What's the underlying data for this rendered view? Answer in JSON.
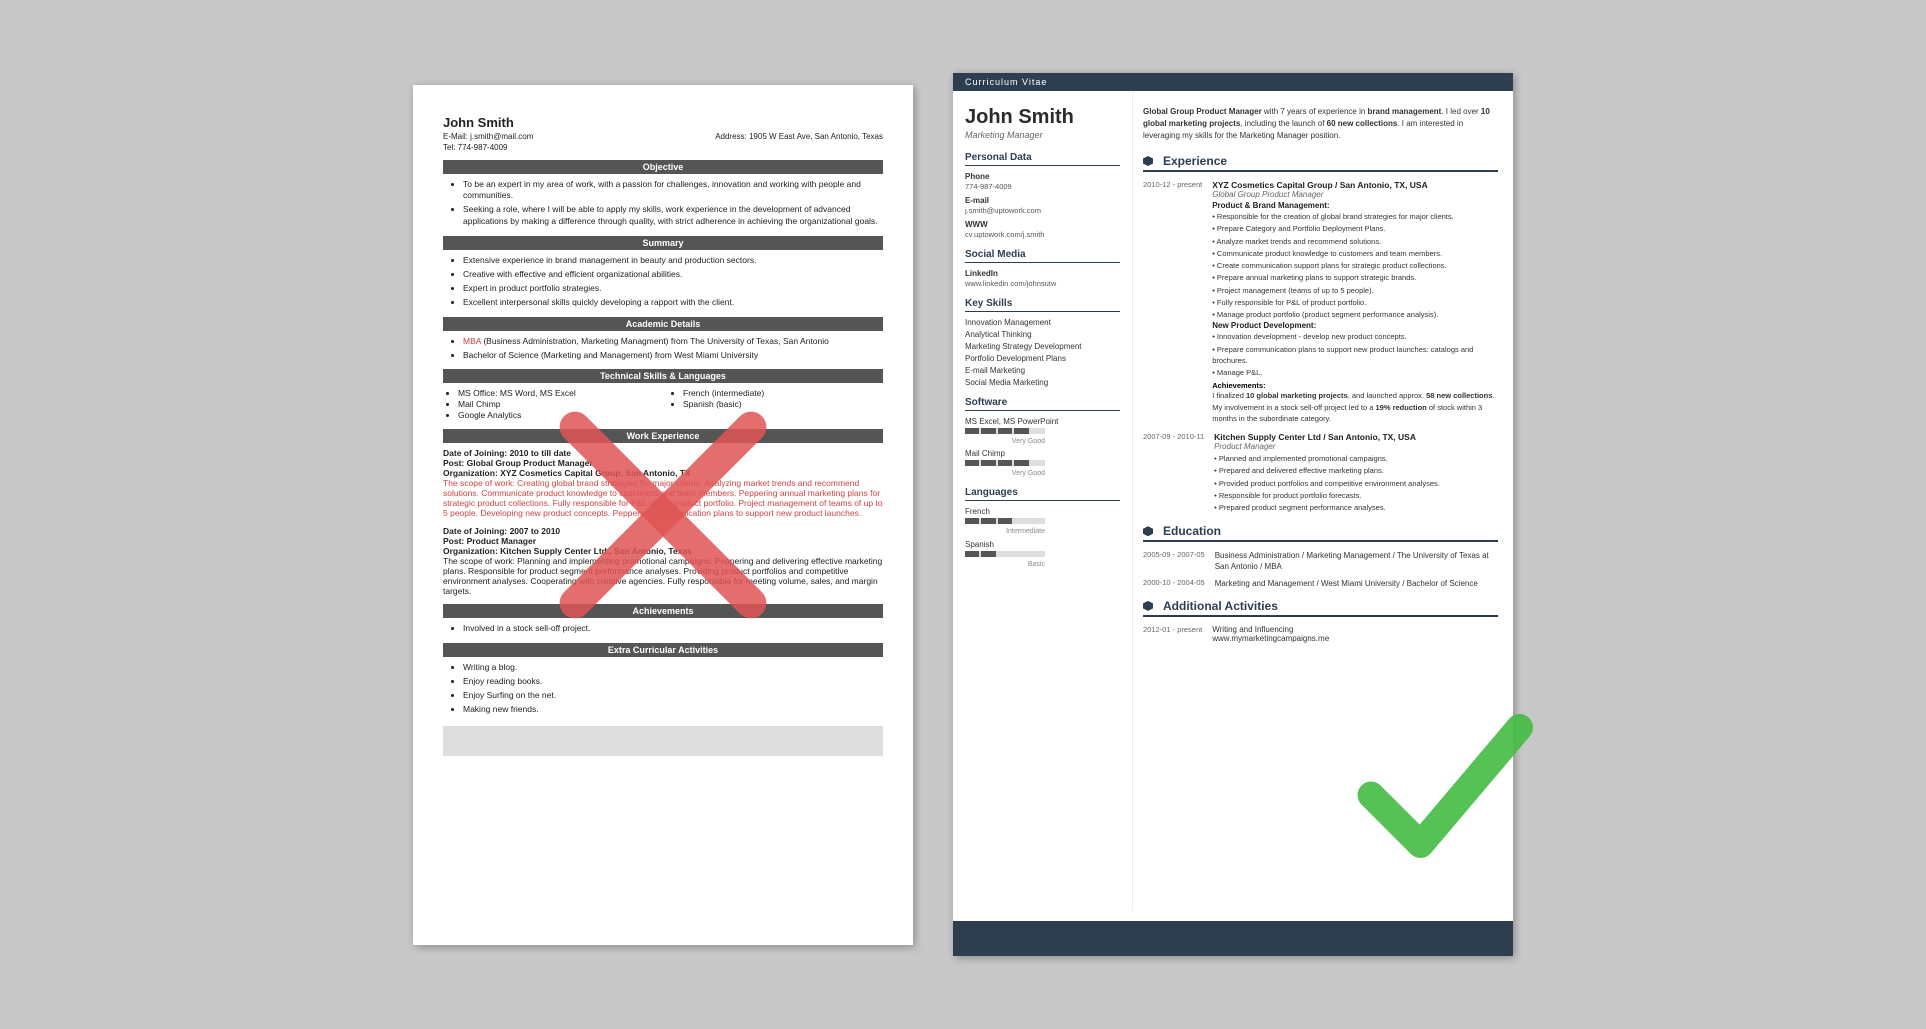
{
  "left_resume": {
    "name": "John Smith",
    "email": "E-Mail: j.smith@mail.com",
    "address": "Address: 1905 W East Ave, San Antonio, Texas",
    "tel": "Tel: 774-987-4009",
    "sections": {
      "objective": {
        "title": "Objective",
        "bullets": [
          "To be an expert in my area of work, with a passion for challenges, innovation and working with people and communities.",
          "Seeking a role, where I will be able to apply my skills, work experience in the development of advanced applications by making a difference through quality, with strict adherence in achieving the organizational goals."
        ]
      },
      "summary": {
        "title": "Summary",
        "bullets": [
          "Extensive experience in brand management in beauty and production sectors.",
          "Creative with effective and efficient organizational abilities.",
          "Expert in product portfolio strategies.",
          "Excellent interpersonal skills quickly developing a rapport with the client."
        ]
      },
      "academic": {
        "title": "Academic Details",
        "items": [
          "MBA (Business Administration, Marketing Managment) from The University of Texas, San Antonio",
          "Bachelor of Science (Marketing and Management) from West Miami University"
        ]
      },
      "technical": {
        "title": "Technical Skills & Languages",
        "left_skills": [
          "MS Office: MS Word, MS Excel",
          "Mail Chimp",
          "Google Analytics"
        ],
        "right_skills": [
          "French (intermediate)",
          "Spanish (basic)"
        ]
      },
      "work_exp": {
        "title": "Work Experience",
        "entries": [
          {
            "date": "Date of Joining: 2010 to till date",
            "post": "Post: Global Group Product Manager",
            "org": "Organization: XYZ Cosmetics Capital Group, San Antonio, TX",
            "scope": "The scope of work: Creating global brand strategies for major clients. Analyzing market trends and recommend solutions. Communicate product knowledge to customers and team members. Peppering annual marketing plans for strategic product collections. Fully responsible for P&L of the product portfolio. Project management of teams of up to 5 people. Developing new product concepts. Peppering communication plans to support new product launches."
          },
          {
            "date": "Date of Joining: 2007 to 2010",
            "post": "Post: Product Manager",
            "org": "Organization: Kitchen Supply Center Ltd., San Antonio, Texas",
            "scope": "The scope of work: Planning and implementing promotional campaigns. Peppering and delivering effective marketing plans. Responsible for product segment performance analyses. Providing product portfolios and competitive environment analyses. Cooperating with creative agencies. Fully responsible for meeting volume, sales, and margin targets."
          }
        ]
      },
      "achievements": {
        "title": "Achievements",
        "bullets": [
          "Involved in a stock sell-off project."
        ]
      },
      "extra": {
        "title": "Extra Curricular Activities",
        "bullets": [
          "Writing a blog.",
          "Enjoy reading books.",
          "Enjoy Surfing on the net.",
          "Making new friends."
        ]
      }
    }
  },
  "right_resume": {
    "cv_label": "Curriculum Vitae",
    "name": "John Smith",
    "title": "Marketing Manager",
    "intro": "Global Group Product Manager with 7 years of experience in brand management. I led over 10 global marketing projects, including the launch of 60 new collections. I am interested in leveraging my skills for the Marketing Manager position.",
    "personal_data": {
      "section": "Personal Data",
      "phone_label": "Phone",
      "phone": "774-987-4009",
      "email_label": "E-mail",
      "email": "j.smith@uptowork.com",
      "www_label": "WWW",
      "www": "cv.uptowork.com/j.smith"
    },
    "social_media": {
      "section": "Social Media",
      "linkedin_label": "LinkedIn",
      "linkedin": "www.linkedin.com/johnsutw"
    },
    "key_skills": {
      "section": "Key Skills",
      "items": [
        "Innovation Management",
        "Analytical Thinking",
        "Marketing Strategy Development",
        "Portfolio Development Plans",
        "E-mail Marketing",
        "Social Media Marketing"
      ]
    },
    "software": {
      "section": "Software",
      "items": [
        {
          "name": "MS Excel, MS PowerPoint",
          "level": 4,
          "max": 5,
          "label": "Very Good"
        },
        {
          "name": "Mail Chimp",
          "level": 4,
          "max": 5,
          "label": "Very Good"
        }
      ]
    },
    "languages": {
      "section": "Languages",
      "items": [
        {
          "name": "French",
          "level": 3,
          "max": 5,
          "label": "Intermediate"
        },
        {
          "name": "Spanish",
          "level": 2,
          "max": 5,
          "label": "Basic"
        }
      ]
    },
    "experience": {
      "section": "Experience",
      "entries": [
        {
          "dates": "2010-12 - present",
          "company": "XYZ Cosmetics Capital Group / San Antonio, TX, USA",
          "role": "Global Group Product Manager",
          "subtitle1": "Product & Brand Management:",
          "bullets1": [
            "Responsible for the creation of global brand strategies for major clients.",
            "Prepare Category and Portfolio Deployment Plans.",
            "Analyze market trends and recommend solutions.",
            "Communicate product knowledge to customers and team members.",
            "Create communication support plans for strategic product collections.",
            "Prepare annual marketing plans to support strategic brands.",
            "Project management (teams of up to 5 people).",
            "Fully responsible for P&L of product portfolio.",
            "Manage product portfolio (product segment performance analysis)."
          ],
          "subtitle2": "New Product Development:",
          "bullets2": [
            "Innovation development - develop new product concepts.",
            "Prepare communication plans to support new product launches: catalogs and brochures.",
            "Manage P&L."
          ],
          "subtitle3": "Achievements:",
          "ach_text": "I finalized 10 global marketing projects, and launched approx. 58 new collections.",
          "ach_text2": "My involvement in a stock sell-off project led to a 19% reduction of stock within 3 months in the subordinate category."
        },
        {
          "dates": "2007-09 - 2010-11",
          "company": "Kitchen Supply Center Ltd / San Antonio, TX, USA",
          "role": "Product Manager",
          "bullets1": [
            "Planned and implemented promotional campaigns.",
            "Prepared and delivered effective marketing plans.",
            "Provided product portfolios and competitive environment analyses.",
            "Responsible for product portfolio forecasts.",
            "Prepared product segment performance analyses."
          ]
        }
      ]
    },
    "education": {
      "section": "Education",
      "entries": [
        {
          "dates": "2005-09 - 2007-05",
          "text": "Business Administration / Marketing Management / The University of Texas at San Antonio / MBA"
        },
        {
          "dates": "2000-10 - 2004-05",
          "text": "Marketing and Management / West Miami University / Bachelor of Science"
        }
      ]
    },
    "activities": {
      "section": "Additional Activities",
      "entries": [
        {
          "dates": "2012-01 - present",
          "text": "Writing and Influencing",
          "url": "www.mymarketingcampaigns.me"
        }
      ]
    }
  }
}
